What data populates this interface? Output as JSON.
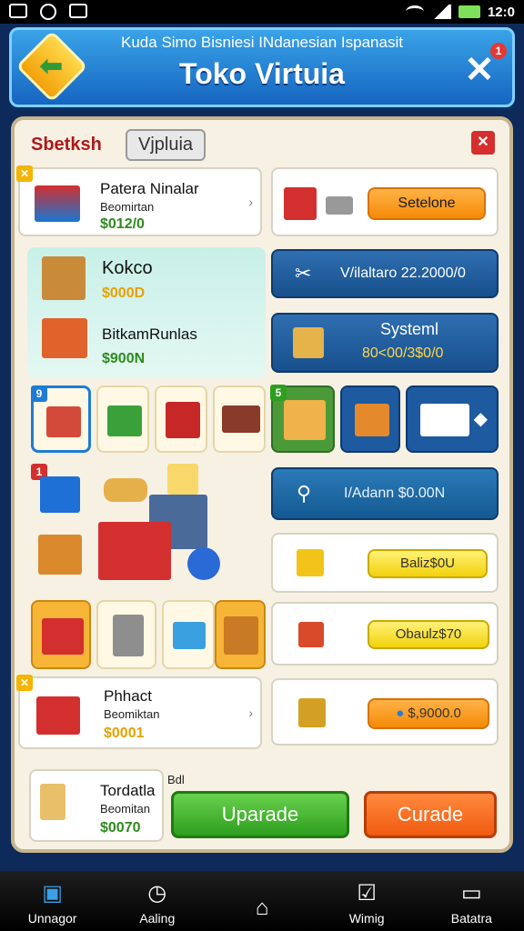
{
  "status": {
    "time": "12:0"
  },
  "header": {
    "subtitle": "Kuda Simo Bisniesi INdanesian Ispanasit",
    "title": "Toko Virtuia"
  },
  "panel": {
    "tab_active": "Sbetksh",
    "tab_search": "Vjpluia"
  },
  "items": [
    {
      "name": "Patera Ninalar",
      "category": "Beomirtan",
      "price": "$012/0"
    },
    {
      "name": "Kokco",
      "category": "",
      "price": "$000D"
    },
    {
      "name": "BitkamRunlas",
      "category": "",
      "price": "$900N"
    },
    {
      "name": "Phhact",
      "category": "Beomiktan",
      "price": "$0001"
    }
  ],
  "actions": {
    "btn1": "Setelone",
    "btn2": "V/ilaltaro 22.2000/0",
    "system_title": "Systeml",
    "system_value": "80<00/3$0/0",
    "btn3": "I/Adann $0.00N",
    "pill1": "Baliz$0U",
    "pill2": "Obaulz$70",
    "pill3": "$,9000.0"
  },
  "badges": {
    "top_notif": "1",
    "grid_a": "9",
    "grid_b": "5",
    "card_big": "1"
  },
  "bottom": {
    "name": "Tordatla",
    "category": "Beomitan",
    "price": "$0070",
    "extra": "Bdl",
    "upgrade": "Uparade",
    "curade": "Curade"
  },
  "nav": [
    {
      "label": "Unnagor",
      "icon": "home-box-icon"
    },
    {
      "label": "Aaling",
      "icon": "clock-icon"
    },
    {
      "label": "",
      "icon": "house-icon"
    },
    {
      "label": "Wimig",
      "icon": "box-check-icon"
    },
    {
      "label": "Batatra",
      "icon": "card-icon"
    }
  ],
  "colors": {
    "accent": "#1565c0",
    "green": "#2e9e1e",
    "orange": "#f05a10",
    "gold": "#f2d20d"
  }
}
